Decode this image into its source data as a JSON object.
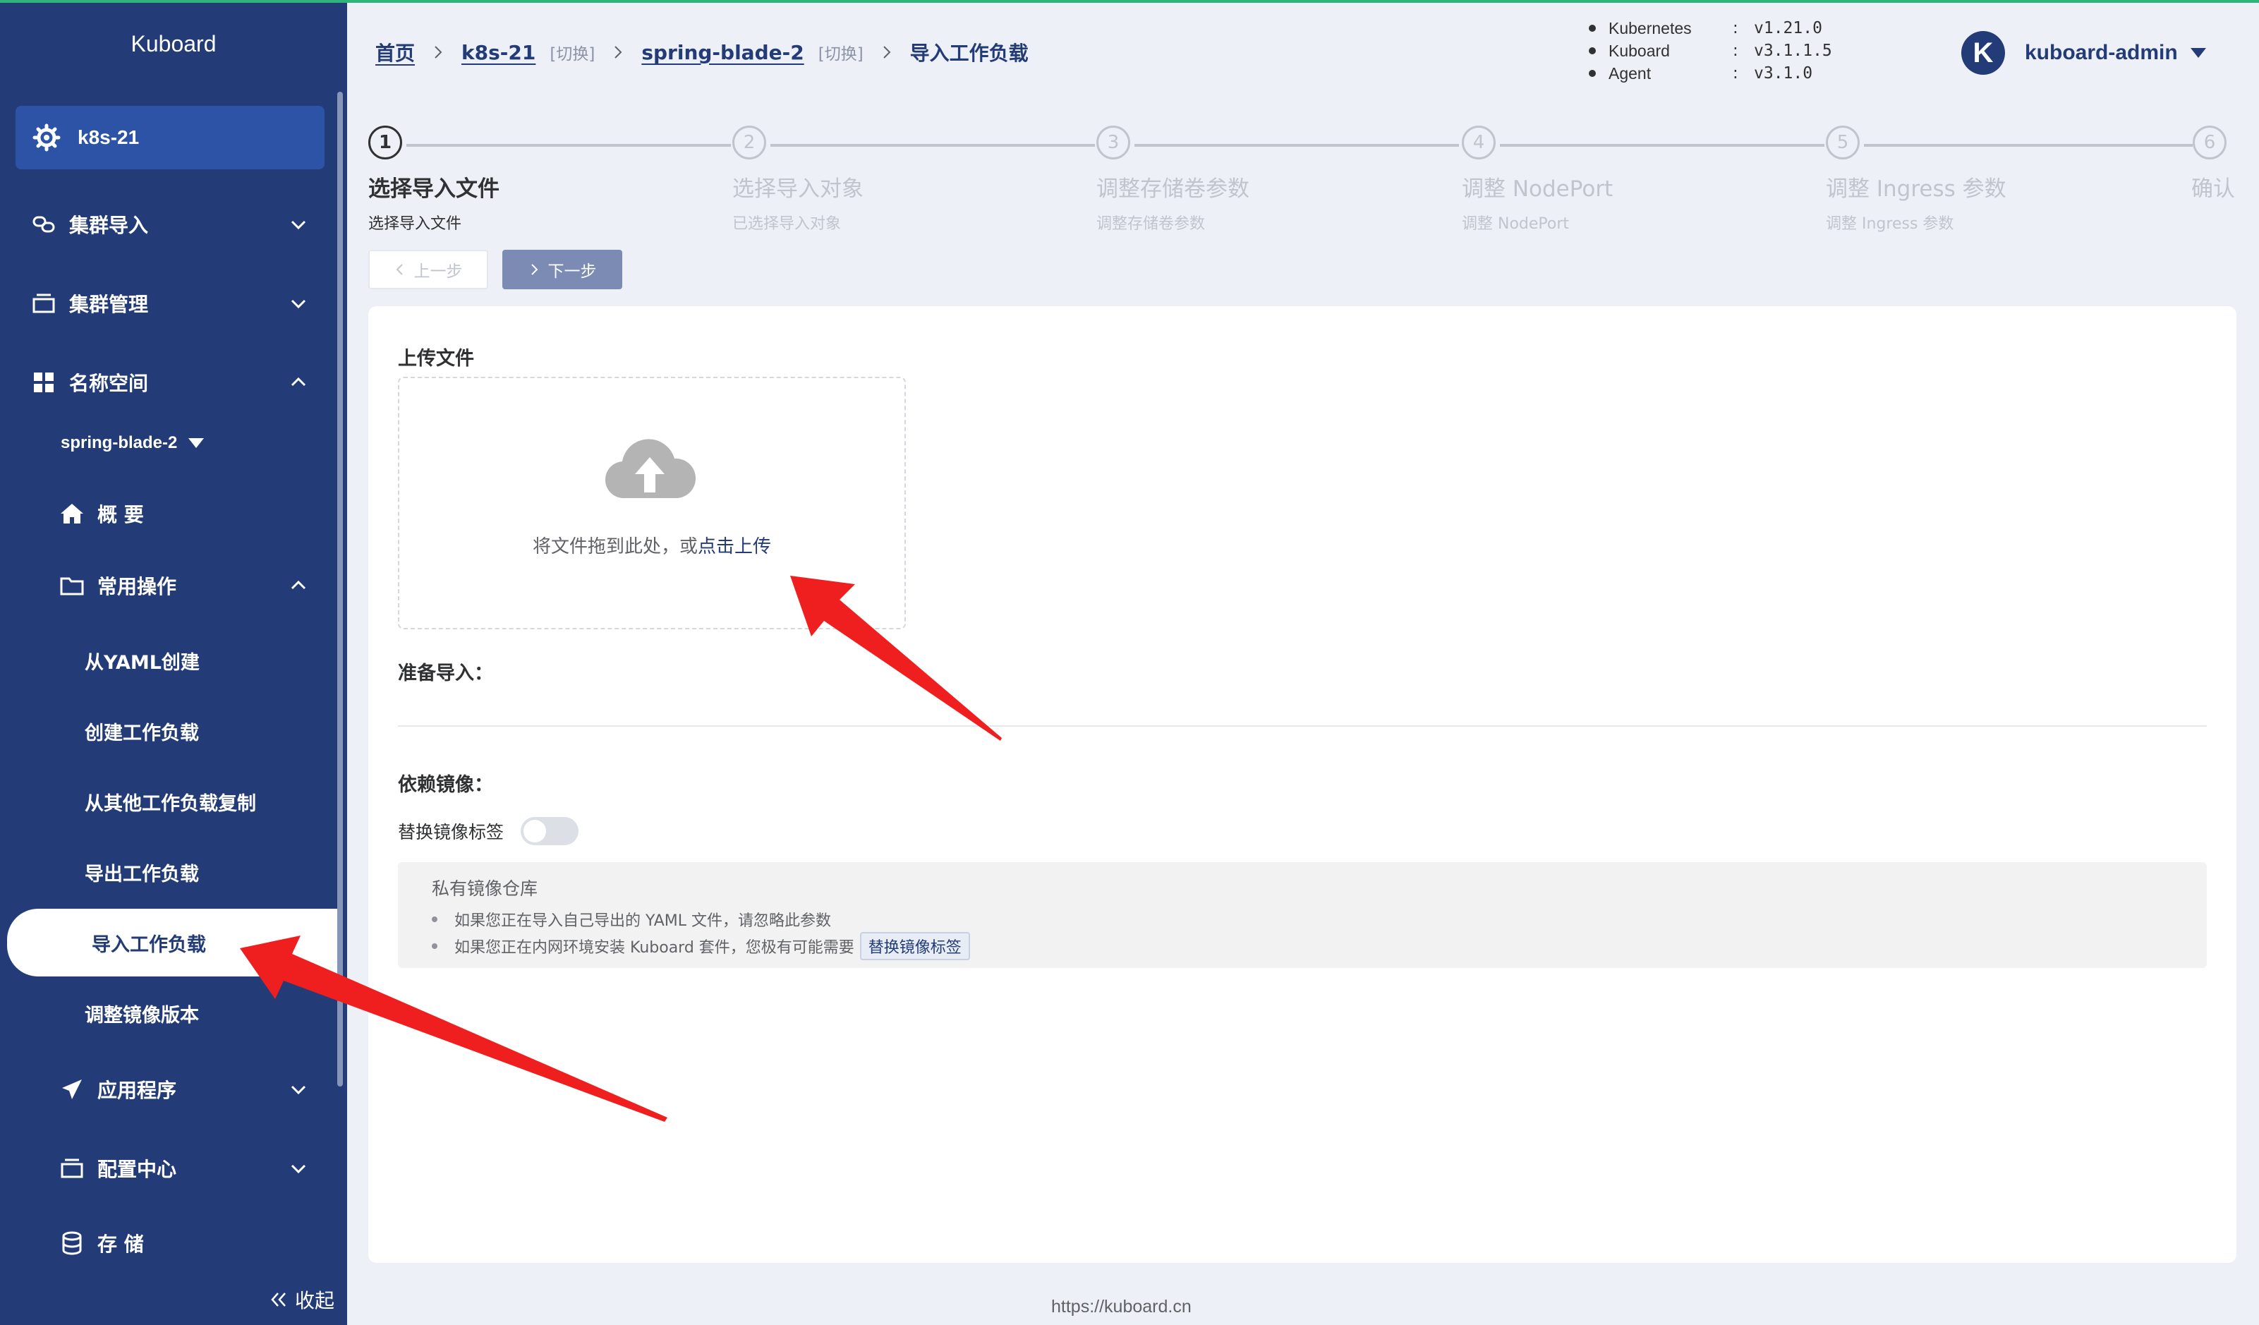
{
  "brand": "Kuboard",
  "cluster": {
    "name": "k8s-21"
  },
  "sidebar": {
    "cluster_import": "集群导入",
    "cluster_manage": "集群管理",
    "namespace": "名称空间",
    "namespace_selected": "spring-blade-2",
    "overview": "概 要",
    "common_ops": "常用操作",
    "ops": [
      "从YAML创建",
      "创建工作负载",
      "从其他工作负载复制",
      "导出工作负载",
      "导入工作负载",
      "调整镜像版本"
    ],
    "apps": "应用程序",
    "config": "配置中心",
    "storage": "存 储",
    "collapse": "收起"
  },
  "breadcrumb": {
    "home": "首页",
    "cluster": "k8s-21",
    "switch1": "[切换]",
    "namespace": "spring-blade-2",
    "switch2": "[切换]",
    "current": "导入工作负载"
  },
  "versions": [
    {
      "name": "Kubernetes",
      "value": "v1.21.0"
    },
    {
      "name": "Kuboard",
      "value": "v3.1.1.5"
    },
    {
      "name": "Agent",
      "value": "v3.1.0"
    }
  ],
  "user": {
    "initial": "K",
    "name": "kuboard-admin"
  },
  "steps": [
    {
      "num": "1",
      "title": "选择导入文件",
      "desc": "选择导入文件",
      "active": true
    },
    {
      "num": "2",
      "title": "选择导入对象",
      "desc": "已选择导入对象"
    },
    {
      "num": "3",
      "title": "调整存储卷参数",
      "desc": "调整存储卷参数"
    },
    {
      "num": "4",
      "title": "调整 NodePort",
      "desc": "调整 NodePort"
    },
    {
      "num": "5",
      "title": "调整 Ingress 参数",
      "desc": "调整 Ingress 参数"
    },
    {
      "num": "6",
      "title": "确认",
      "desc": ""
    }
  ],
  "buttons": {
    "prev": "上一步",
    "next": "下一步"
  },
  "upload": {
    "label": "上传文件",
    "hint": "将文件拖到此处，或",
    "hint_link": "点击上传"
  },
  "prepare_label": "准备导入：",
  "depends_label": "依赖镜像：",
  "replace_tag_label": "替换镜像标签",
  "notice": {
    "title": "私有镜像仓库",
    "line1": "如果您正在导入自己导出的 YAML 文件，请忽略此参数",
    "line2": "如果您正在内网环境安装 Kuboard 套件，您极有可能需要",
    "tag": "替换镜像标签"
  },
  "footer": "https://kuboard.cn",
  "colors": {
    "sidebar": "#233c77",
    "active_card": "#2d53a6",
    "accent": "#233c77",
    "arrow": "#f01f1f"
  }
}
